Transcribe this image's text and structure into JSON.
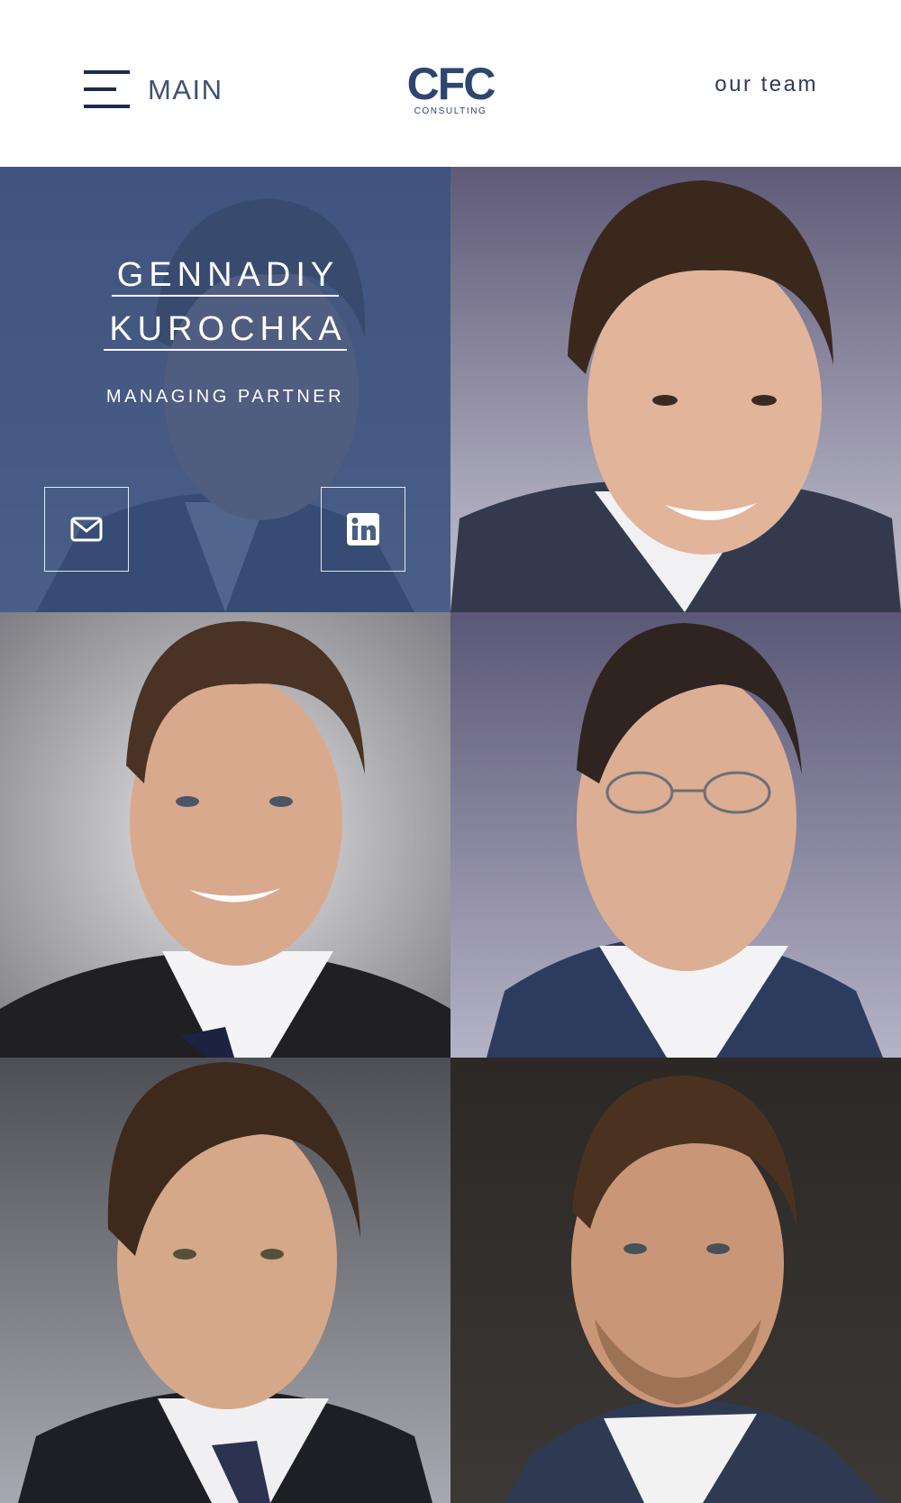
{
  "header": {
    "menu_label": "MAIN",
    "logo_mark": "CFC",
    "logo_sub": "CONSULTING",
    "section_label": "our team"
  },
  "colors": {
    "brand": "#2d4670",
    "overlay": "#38507d",
    "menu_text": "#3f5074"
  },
  "team": {
    "featured": {
      "name_line1": "GENNADIY",
      "name_line2": "KUROCHKA",
      "role": "MANAGING PARTNER",
      "email_icon": "envelope-icon",
      "linkedin_icon": "linkedin-icon"
    },
    "portraits": [
      {
        "background": "#a9a7be"
      },
      {
        "background": "#bdbdc2"
      },
      {
        "background": "#8a86a6"
      },
      {
        "background": "#75777f"
      },
      {
        "background": "#2f2c2a"
      }
    ]
  }
}
